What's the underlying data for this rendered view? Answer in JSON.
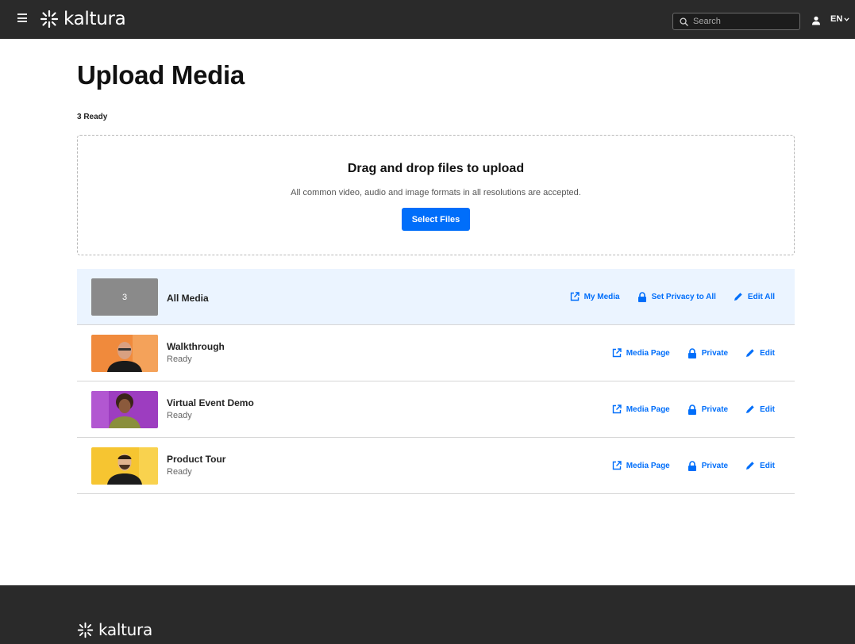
{
  "header": {
    "brand": "kaltura",
    "search_placeholder": "Search",
    "language": "EN"
  },
  "page": {
    "title": "Upload Media",
    "ready_count": "3 Ready"
  },
  "dropzone": {
    "title": "Drag and drop files to upload",
    "subtitle": "All common video, audio and image formats in all resolutions are accepted.",
    "button": "Select Files"
  },
  "all_media": {
    "count": "3",
    "name": "All Media",
    "actions": {
      "my_media": "My Media",
      "privacy": "Set Privacy to All",
      "edit": "Edit All"
    }
  },
  "items": [
    {
      "name": "Walkthrough",
      "status": "Ready",
      "thumb_bg": "#f08a3c",
      "shirt": "#1a1a1a",
      "skin": "#d9a081",
      "actions": {
        "media_page": "Media Page",
        "privacy": "Private",
        "edit": "Edit"
      }
    },
    {
      "name": "Virtual Event Demo",
      "status": "Ready",
      "thumb_bg": "#9d3dc0",
      "shirt": "#8a8f3c",
      "skin": "#8b5a3c",
      "actions": {
        "media_page": "Media Page",
        "privacy": "Private",
        "edit": "Edit"
      }
    },
    {
      "name": "Product Tour",
      "status": "Ready",
      "thumb_bg": "#f6c531",
      "shirt": "#1c1c1c",
      "skin": "#e0b28f",
      "actions": {
        "media_page": "Media Page",
        "privacy": "Private",
        "edit": "Edit"
      }
    }
  ],
  "footer": {
    "brand": "kaltura"
  },
  "colors": {
    "accent": "#006efa",
    "topbar": "#2a2a2a",
    "highlight_row": "#ebf4ff"
  }
}
